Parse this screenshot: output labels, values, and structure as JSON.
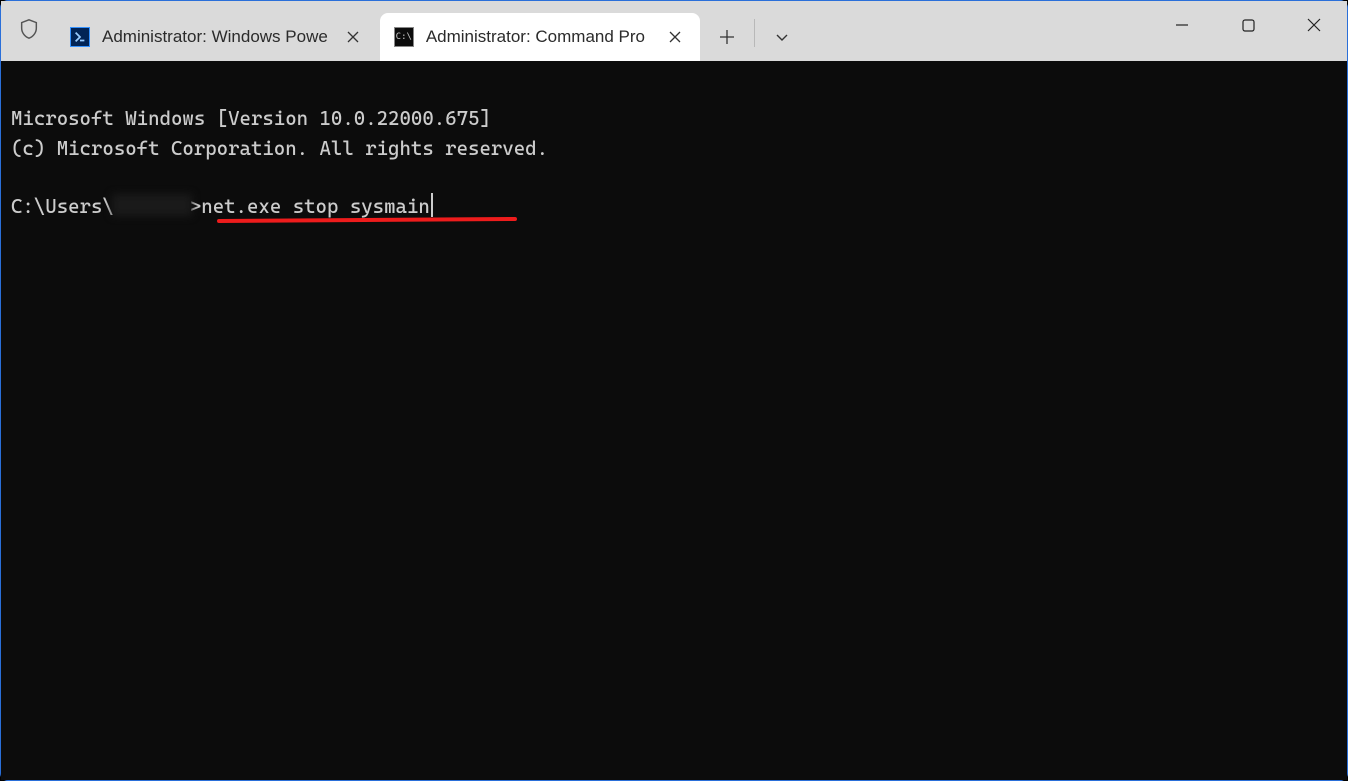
{
  "tabs": [
    {
      "label": "Administrator: Windows Powe",
      "icon": "powershell",
      "active": false
    },
    {
      "label": "Administrator: Command Pro",
      "icon": "cmd",
      "active": true
    }
  ],
  "terminal": {
    "line1": "Microsoft Windows [Version 10.0.22000.675]",
    "line2": "(c) Microsoft Corporation. All rights reserved.",
    "blank": "",
    "prompt_prefix": "C:\\Users\\",
    "prompt_suffix": ">",
    "command": "net.exe stop sysmain"
  },
  "annotation": {
    "underline_color": "#ee1c1c"
  }
}
